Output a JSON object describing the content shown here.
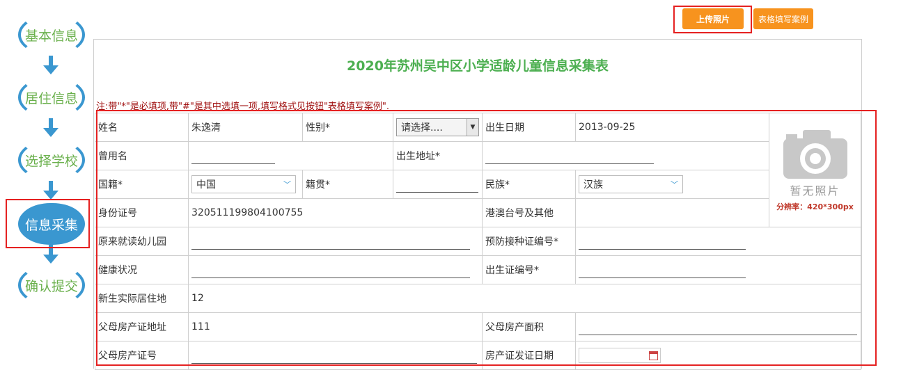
{
  "steps": [
    "基本信息",
    "居住信息",
    "选择学校",
    "信息采集",
    "确认提交"
  ],
  "buttons": {
    "upload_photo": "上传照片",
    "form_example": "表格填写案例"
  },
  "form_title": "2020年苏州吴中区小学适龄儿童信息采集表",
  "note": "注:带\"*\"是必填项,带\"#\"是其中选填一项,填写格式见按钮\"表格填写案例\".",
  "fields": {
    "name_label": "姓名",
    "name_value": "朱逸清",
    "gender_label": "性别*",
    "gender_placeholder": "请选择....",
    "birth_date_label": "出生日期",
    "birth_date_value": "2013-09-25",
    "former_name_label": "曾用名",
    "birthplace_label": "出生地址*",
    "nationality_label": "国籍*",
    "nationality_value": "中国",
    "native_place_label": "籍贯*",
    "ethnicity_label": "民族*",
    "ethnicity_value": "汉族",
    "id_label": "身份证号",
    "id_value": "320511199804100755",
    "hk_macao_tw_label": "港澳台号及其他",
    "kindergarten_label": "原来就读幼儿园",
    "vaccine_label": "预防接种证编号*",
    "health_label": "健康状况",
    "birth_cert_label": "出生证编号*",
    "residence_label": "新生实际居住地",
    "residence_value": "12",
    "property_address_label": "父母房产证地址",
    "property_address_value": "111",
    "property_area_label": "父母房产面积",
    "property_cert_label": "父母房产证号",
    "property_date_label": "房产证发证日期"
  },
  "photo": {
    "placeholder_text": "暂无照片",
    "resolution": "分辨率：420*300px"
  },
  "colors": {
    "accent_blue": "#3a97d0",
    "step_green": "#6ab04c",
    "orange": "#f7931e",
    "required_red": "#a01010",
    "highlight_red": "#e52121"
  }
}
